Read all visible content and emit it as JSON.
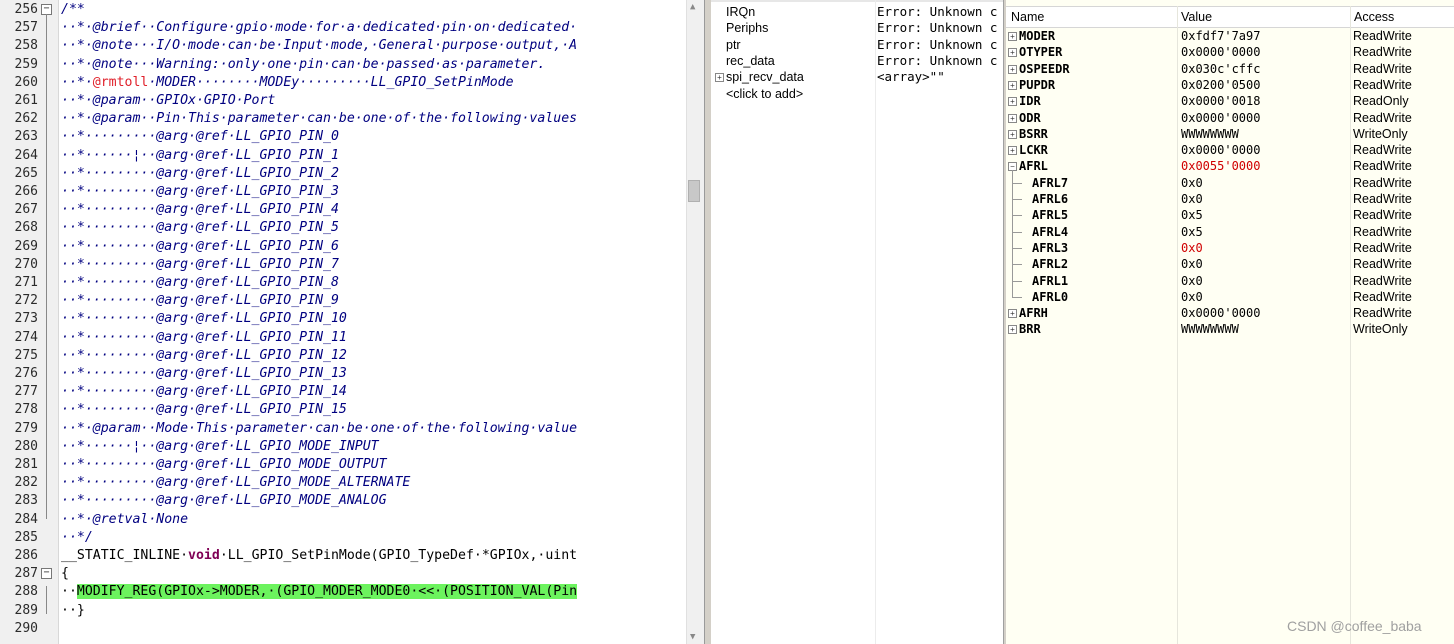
{
  "editor": {
    "lines": [
      {
        "n": "256",
        "fold": "minus",
        "segs": [
          {
            "t": "/**",
            "c": "cm"
          }
        ]
      },
      {
        "n": "257",
        "segs": [
          {
            "t": "··*·@brief··Configure·gpio·mode·for·a·dedicated·pin·on·dedicated·",
            "c": "cm"
          }
        ]
      },
      {
        "n": "258",
        "segs": [
          {
            "t": "··*·@note···I/O·mode·can·be·Input·mode,·General·purpose·output,·A",
            "c": "cm"
          }
        ]
      },
      {
        "n": "259",
        "segs": [
          {
            "t": "··*·@note···Warning:·only·one·pin·can·be·passed·as·parameter.",
            "c": "cm"
          }
        ]
      },
      {
        "n": "260",
        "segs": [
          {
            "t": "··*·",
            "c": "cm"
          },
          {
            "t": "@rmtoll",
            "c": "tg"
          },
          {
            "t": "·MODER········MODEy·········LL_GPIO_SetPinMode",
            "c": "cm"
          }
        ]
      },
      {
        "n": "261",
        "segs": [
          {
            "t": "··*·@param··GPIOx·GPIO·Port",
            "c": "cm"
          }
        ]
      },
      {
        "n": "262",
        "segs": [
          {
            "t": "··*·@param··Pin·This·parameter·can·be·one·of·the·following·values",
            "c": "cm"
          }
        ]
      },
      {
        "n": "263",
        "segs": [
          {
            "t": "··*·········@arg·@ref·LL_GPIO_PIN_0",
            "c": "cm"
          }
        ]
      },
      {
        "n": "264",
        "segs": [
          {
            "t": "··*······¦··@arg·@ref·LL_GPIO_PIN_1",
            "c": "cm"
          }
        ]
      },
      {
        "n": "265",
        "segs": [
          {
            "t": "··*·········@arg·@ref·LL_GPIO_PIN_2",
            "c": "cm"
          }
        ]
      },
      {
        "n": "266",
        "segs": [
          {
            "t": "··*·········@arg·@ref·LL_GPIO_PIN_3",
            "c": "cm"
          }
        ]
      },
      {
        "n": "267",
        "segs": [
          {
            "t": "··*·········@arg·@ref·LL_GPIO_PIN_4",
            "c": "cm"
          }
        ]
      },
      {
        "n": "268",
        "segs": [
          {
            "t": "··*·········@arg·@ref·LL_GPIO_PIN_5",
            "c": "cm"
          }
        ]
      },
      {
        "n": "269",
        "segs": [
          {
            "t": "··*·········@arg·@ref·LL_GPIO_PIN_6",
            "c": "cm"
          }
        ]
      },
      {
        "n": "270",
        "segs": [
          {
            "t": "··*·········@arg·@ref·LL_GPIO_PIN_7",
            "c": "cm"
          }
        ]
      },
      {
        "n": "271",
        "segs": [
          {
            "t": "··*·········@arg·@ref·LL_GPIO_PIN_8",
            "c": "cm"
          }
        ]
      },
      {
        "n": "272",
        "segs": [
          {
            "t": "··*·········@arg·@ref·LL_GPIO_PIN_9",
            "c": "cm"
          }
        ]
      },
      {
        "n": "273",
        "segs": [
          {
            "t": "··*·········@arg·@ref·LL_GPIO_PIN_10",
            "c": "cm"
          }
        ]
      },
      {
        "n": "274",
        "segs": [
          {
            "t": "··*·········@arg·@ref·LL_GPIO_PIN_11",
            "c": "cm"
          }
        ]
      },
      {
        "n": "275",
        "segs": [
          {
            "t": "··*·········@arg·@ref·LL_GPIO_PIN_12",
            "c": "cm"
          }
        ]
      },
      {
        "n": "276",
        "segs": [
          {
            "t": "··*·········@arg·@ref·LL_GPIO_PIN_13",
            "c": "cm"
          }
        ]
      },
      {
        "n": "277",
        "segs": [
          {
            "t": "··*·········@arg·@ref·LL_GPIO_PIN_14",
            "c": "cm"
          }
        ]
      },
      {
        "n": "278",
        "segs": [
          {
            "t": "··*·········@arg·@ref·LL_GPIO_PIN_15",
            "c": "cm"
          }
        ]
      },
      {
        "n": "279",
        "segs": [
          {
            "t": "··*·@param··Mode·This·parameter·can·be·one·of·the·following·value",
            "c": "cm"
          }
        ]
      },
      {
        "n": "280",
        "segs": [
          {
            "t": "··*······¦··@arg·@ref·LL_GPIO_MODE_INPUT",
            "c": "cm"
          }
        ]
      },
      {
        "n": "281",
        "segs": [
          {
            "t": "··*·········@arg·@ref·LL_GPIO_MODE_OUTPUT",
            "c": "cm"
          }
        ]
      },
      {
        "n": "282",
        "segs": [
          {
            "t": "··*·········@arg·@ref·LL_GPIO_MODE_ALTERNATE",
            "c": "cm"
          }
        ]
      },
      {
        "n": "283",
        "segs": [
          {
            "t": "··*·········@arg·@ref·LL_GPIO_MODE_ANALOG",
            "c": "cm"
          }
        ]
      },
      {
        "n": "284",
        "segs": [
          {
            "t": "··*·@retval·None",
            "c": "cm"
          }
        ]
      },
      {
        "n": "285",
        "segs": [
          {
            "t": "··*/",
            "c": "cm"
          }
        ]
      },
      {
        "n": "286",
        "segs": [
          {
            "t": "__STATIC_INLINE·",
            "c": "nm"
          },
          {
            "t": "void",
            "c": "kw"
          },
          {
            "t": "·LL_GPIO_SetPinMode(GPIO_TypeDef·*GPIOx,·uint",
            "c": "nm"
          }
        ]
      },
      {
        "n": "287",
        "fold": "minus",
        "segs": [
          {
            "t": "{",
            "c": "nm"
          }
        ]
      },
      {
        "n": "288",
        "segs": [
          {
            "t": "··",
            "c": "nm"
          },
          {
            "t": "MODIFY_REG(GPIOx->MODER,·(GPIO_MODER_MODE0·<<·(POSITION_VAL(Pin",
            "c": "hl"
          }
        ]
      },
      {
        "n": "289",
        "segs": [
          {
            "t": "··}",
            "c": "nm"
          }
        ]
      },
      {
        "n": "290",
        "segs": [
          {
            "t": "",
            "c": "nm"
          }
        ]
      }
    ]
  },
  "watch": {
    "rows": [
      {
        "name": "IRQn",
        "value": "Error: Unknown c",
        "expand": false
      },
      {
        "name": "Periphs",
        "value": "Error: Unknown c",
        "expand": false
      },
      {
        "name": "ptr",
        "value": "Error: Unknown c",
        "expand": false
      },
      {
        "name": "rec_data",
        "value": "Error: Unknown c",
        "expand": false
      },
      {
        "name": "spi_recv_data",
        "value": "<array>\"\"",
        "expand": true
      },
      {
        "name": "<click to add>",
        "value": "",
        "expand": false
      }
    ]
  },
  "registers": {
    "headers": {
      "name": "Name",
      "value": "Value",
      "access": "Access"
    },
    "rows": [
      {
        "name": "MODER",
        "value": "0xfdf7'7a97",
        "access": "ReadWrite",
        "level": 0,
        "expand": "plus"
      },
      {
        "name": "OTYPER",
        "value": "0x0000'0000",
        "access": "ReadWrite",
        "level": 0,
        "expand": "plus"
      },
      {
        "name": "OSPEEDR",
        "value": "0x030c'cffc",
        "access": "ReadWrite",
        "level": 0,
        "expand": "plus"
      },
      {
        "name": "PUPDR",
        "value": "0x0200'0500",
        "access": "ReadWrite",
        "level": 0,
        "expand": "plus"
      },
      {
        "name": "IDR",
        "value": "0x0000'0018",
        "access": "ReadOnly",
        "level": 0,
        "expand": "plus"
      },
      {
        "name": "ODR",
        "value": "0x0000'0000",
        "access": "ReadWrite",
        "level": 0,
        "expand": "plus"
      },
      {
        "name": "BSRR",
        "value": "WWWWWWWW",
        "access": "WriteOnly",
        "level": 0,
        "expand": "plus"
      },
      {
        "name": "LCKR",
        "value": "0x0000'0000",
        "access": "ReadWrite",
        "level": 0,
        "expand": "plus"
      },
      {
        "name": "AFRL",
        "value": "0x0055'0000",
        "access": "ReadWrite",
        "level": 0,
        "expand": "minus",
        "changed": true
      },
      {
        "name": "AFRL7",
        "value": "0x0",
        "access": "ReadWrite",
        "level": 1
      },
      {
        "name": "AFRL6",
        "value": "0x0",
        "access": "ReadWrite",
        "level": 1
      },
      {
        "name": "AFRL5",
        "value": "0x5",
        "access": "ReadWrite",
        "level": 1
      },
      {
        "name": "AFRL4",
        "value": "0x5",
        "access": "ReadWrite",
        "level": 1
      },
      {
        "name": "AFRL3",
        "value": "0x0",
        "access": "ReadWrite",
        "level": 1,
        "changed": true
      },
      {
        "name": "AFRL2",
        "value": "0x0",
        "access": "ReadWrite",
        "level": 1
      },
      {
        "name": "AFRL1",
        "value": "0x0",
        "access": "ReadWrite",
        "level": 1
      },
      {
        "name": "AFRL0",
        "value": "0x0",
        "access": "ReadWrite",
        "level": 1
      },
      {
        "name": "AFRH",
        "value": "0x0000'0000",
        "access": "ReadWrite",
        "level": 0,
        "expand": "plus"
      },
      {
        "name": "BRR",
        "value": "WWWWWWWW",
        "access": "WriteOnly",
        "level": 0,
        "expand": "plus"
      }
    ]
  },
  "watermark": "CSDN @coffee_baba",
  "colors": {
    "highlight": "#6cf35e",
    "changed": "#d00000",
    "comment": "#000080",
    "tag": "#e0202a"
  }
}
